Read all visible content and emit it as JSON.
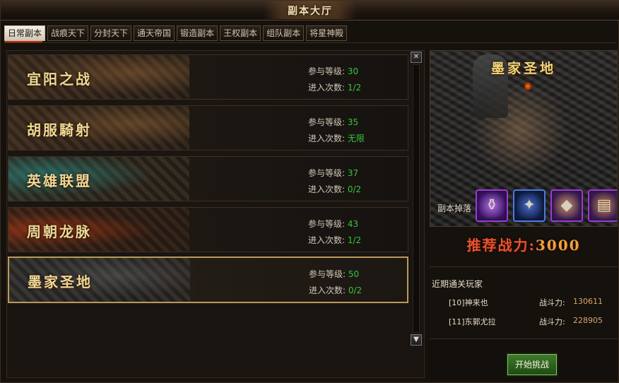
{
  "window": {
    "title": "副本大厅"
  },
  "tabs": [
    {
      "label": "日常副本",
      "active": true
    },
    {
      "label": "战痕天下"
    },
    {
      "label": "分封天下"
    },
    {
      "label": "通天帝国"
    },
    {
      "label": "锻造副本"
    },
    {
      "label": "王权副本"
    },
    {
      "label": "组队副本"
    },
    {
      "label": "将星神殿"
    }
  ],
  "dungeons": [
    {
      "name": "宜阳之战",
      "level_label": "参与等级:",
      "level": "30",
      "entries_label": "进入次数:",
      "entries": "1/2"
    },
    {
      "name": "胡服騎射",
      "level_label": "参与等级:",
      "level": "35",
      "entries_label": "进入次数:",
      "entries": "无限"
    },
    {
      "name": "英雄联盟",
      "level_label": "参与等级:",
      "level": "37",
      "entries_label": "进入次数:",
      "entries": "0/2"
    },
    {
      "name": "周朝龙脉",
      "level_label": "参与等级:",
      "level": "43",
      "entries_label": "进入次数:",
      "entries": "1/2"
    },
    {
      "name": "墨家圣地",
      "level_label": "参与等级:",
      "level": "50",
      "entries_label": "进入次数:",
      "entries": "0/2",
      "selected": true
    }
  ],
  "scrollbar": {
    "up_glyph": "✕",
    "down_glyph": "▼"
  },
  "preview": {
    "name": "墨家圣地",
    "drop_label": "副本掉落",
    "drops": [
      "potion-icon",
      "claw-icon",
      "ore-icon",
      "scroll-icon"
    ]
  },
  "recommend": {
    "label": "推荐战力:",
    "value": "3000"
  },
  "recent": {
    "title": "近期通关玩家",
    "power_label": "战斗力:",
    "players": [
      {
        "name": "[10]神来也",
        "power": "130611"
      },
      {
        "name": "[11]东郭尤拉",
        "power": "228905"
      }
    ]
  },
  "actions": {
    "start": "开始挑战"
  },
  "colors": {
    "accent_green": "#38c43b",
    "title_gold": "#f2d896",
    "power_red": "#e8532e"
  }
}
